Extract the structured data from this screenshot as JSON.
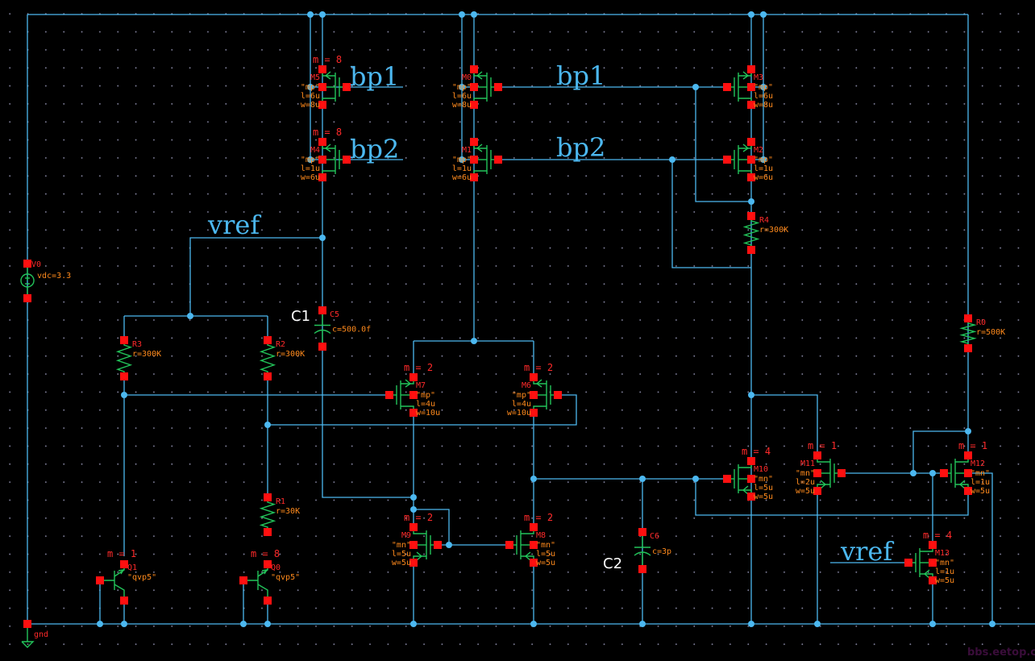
{
  "net_labels": {
    "bp1_a": "bp1",
    "bp1_b": "bp1",
    "bp2_a": "bp2",
    "bp2_b": "bp2",
    "vref_a": "vref",
    "vref_b": "vref",
    "c1": "C1",
    "c2": "C2"
  },
  "devices": {
    "M5": {
      "name": "M5",
      "model": "\"mp\"",
      "l": "l=6u",
      "w": "w=8u",
      "m": "m = 8"
    },
    "M4": {
      "name": "M4",
      "model": "\"mp\"",
      "l": "l=1u",
      "w": "w=6u",
      "m": "m = 8"
    },
    "M0": {
      "name": "M0",
      "model": "\"mp\"",
      "l": "l=6u",
      "w": "w=8u"
    },
    "M1": {
      "name": "M1",
      "model": "\"mp\"",
      "l": "l=1u",
      "w": "w=6u"
    },
    "M3": {
      "name": "M3",
      "model": "\"mp\"",
      "l": "l=6u",
      "w": "w=8u"
    },
    "M2": {
      "name": "M2",
      "model": "\"mp\"",
      "l": "l=1u",
      "w": "w=6u"
    },
    "M7": {
      "name": "M7",
      "model": "\"mp\"",
      "l": "l=4u",
      "w": "w=10u",
      "m": "m = 2"
    },
    "M6": {
      "name": "M6",
      "model": "\"mp\"",
      "l": "l=4u",
      "w": "w=10u",
      "m": "m = 2"
    },
    "M9": {
      "name": "M9",
      "model": "\"mn\"",
      "l": "l=5u",
      "w": "w=5u",
      "m": "m = 2"
    },
    "M8": {
      "name": "M8",
      "model": "\"mn\"",
      "l": "l=5u",
      "w": "w=5u",
      "m": "m = 2"
    },
    "M10": {
      "name": "M10",
      "model": "\"mn\"",
      "l": "l=5u",
      "w": "w=5u",
      "m": "m = 4"
    },
    "M11": {
      "name": "M11",
      "model": "\"mn\"",
      "l": "l=2u",
      "w": "w=5u",
      "m": "m = 1"
    },
    "M12": {
      "name": "M12",
      "model": "\"mn\"",
      "l": "l=1u",
      "w": "w=5u",
      "m": "m = 1"
    },
    "M13": {
      "name": "M13",
      "model": "\"mn\"",
      "l": "l=1u",
      "w": "w=5u",
      "m": "m = 4"
    },
    "R3": {
      "name": "R3",
      "value": "r=300K"
    },
    "R2": {
      "name": "R2",
      "value": "r=300K"
    },
    "R1": {
      "name": "R1",
      "value": "r=30K"
    },
    "R4": {
      "name": "R4",
      "value": "r=300K"
    },
    "R0": {
      "name": "R0",
      "value": "r=500K"
    },
    "C5": {
      "name": "C5",
      "value": "c=500.0f"
    },
    "C6": {
      "name": "C6",
      "value": "c=3p"
    },
    "V0": {
      "name": "V0",
      "value": "vdc=3.3"
    },
    "Q1": {
      "name": "Q1",
      "model": "\"qvp5\"",
      "m": "m = 1"
    },
    "Q0": {
      "name": "Q0",
      "model": "\"qvp5\"",
      "m": "m = 8"
    },
    "gnd": {
      "name": "gnd"
    }
  },
  "watermark": "bbs.eetop.cn",
  "colors": {
    "wire": "#4cb8f0",
    "device": "#22c45a",
    "pin": "#ff1010",
    "instance_name": "#ff2a2a",
    "property": "#ff8a1c",
    "background": "#000000"
  }
}
